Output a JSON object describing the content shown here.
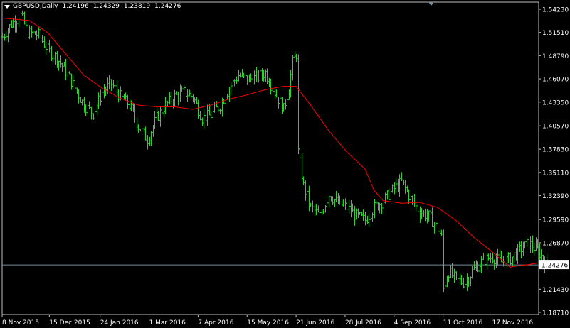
{
  "window": {
    "symbol": "GBPUSD",
    "timeframe": "Daily",
    "ohlc": [
      "1.24196",
      "1.24329",
      "1.23819",
      "1.24276"
    ]
  },
  "colors": {
    "background": "#000000",
    "bar": "#32cd32",
    "moving_average": "#ff0000",
    "axis": "#c0c0c0",
    "current_price_line": "#778899",
    "current_price_label_bg": "#ffffff",
    "current_price_label_fg": "#000000"
  },
  "chart_data": {
    "type": "ohlc-bar",
    "y_ticks": [
      "1.54230",
      "1.51510",
      "1.48790",
      "1.46070",
      "1.43350",
      "1.40570",
      "1.37830",
      "1.35110",
      "1.32390",
      "1.29590",
      "1.26870",
      "1.24276",
      "1.21430",
      "1.18710"
    ],
    "y_tick_values": [
      1.5423,
      1.5151,
      1.4879,
      1.4607,
      1.4335,
      1.4057,
      1.3783,
      1.3511,
      1.3239,
      1.2959,
      1.2687,
      1.24276,
      1.2143,
      1.1871
    ],
    "ylim": [
      1.1871,
      1.5423
    ],
    "current_price": "1.24276",
    "x_ticks": [
      "8 Nov 2015",
      "15 Dec 2015",
      "24 Jan 2016",
      "1 Mar 2016",
      "7 Apr 2016",
      "15 May 2016",
      "21 Jun 2016",
      "28 Jul 2016",
      "4 Sep 2016",
      "11 Oct 2016",
      "17 Nov 2016"
    ],
    "x_tick_bar_index": [
      0,
      26,
      54,
      81,
      108,
      135,
      162,
      189,
      216,
      243,
      270
    ],
    "price_path": [
      [
        0,
        1.51
      ],
      [
        5,
        1.525
      ],
      [
        10,
        1.535
      ],
      [
        14,
        1.515
      ],
      [
        20,
        1.512
      ],
      [
        25,
        1.495
      ],
      [
        30,
        1.485
      ],
      [
        35,
        1.47
      ],
      [
        40,
        1.45
      ],
      [
        45,
        1.43
      ],
      [
        50,
        1.42
      ],
      [
        55,
        1.445
      ],
      [
        60,
        1.455
      ],
      [
        65,
        1.44
      ],
      [
        70,
        1.43
      ],
      [
        75,
        1.405
      ],
      [
        80,
        1.39
      ],
      [
        85,
        1.415
      ],
      [
        90,
        1.43
      ],
      [
        95,
        1.44
      ],
      [
        100,
        1.445
      ],
      [
        105,
        1.44
      ],
      [
        110,
        1.415
      ],
      [
        115,
        1.418
      ],
      [
        120,
        1.43
      ],
      [
        125,
        1.45
      ],
      [
        130,
        1.465
      ],
      [
        135,
        1.46
      ],
      [
        140,
        1.462
      ],
      [
        145,
        1.468
      ],
      [
        150,
        1.445
      ],
      [
        155,
        1.425
      ],
      [
        158,
        1.45
      ],
      [
        160,
        1.48
      ],
      [
        162,
        1.49
      ],
      [
        163,
        1.375
      ],
      [
        166,
        1.335
      ],
      [
        170,
        1.31
      ],
      [
        175,
        1.3
      ],
      [
        180,
        1.325
      ],
      [
        185,
        1.315
      ],
      [
        190,
        1.31
      ],
      [
        195,
        1.3
      ],
      [
        200,
        1.295
      ],
      [
        205,
        1.31
      ],
      [
        210,
        1.318
      ],
      [
        215,
        1.33
      ],
      [
        220,
        1.34
      ],
      [
        225,
        1.32
      ],
      [
        230,
        1.305
      ],
      [
        235,
        1.3
      ],
      [
        240,
        1.285
      ],
      [
        242,
        1.275
      ],
      [
        243,
        1.215
      ],
      [
        246,
        1.235
      ],
      [
        250,
        1.225
      ],
      [
        255,
        1.222
      ],
      [
        260,
        1.238
      ],
      [
        265,
        1.248
      ],
      [
        270,
        1.252
      ],
      [
        275,
        1.246
      ],
      [
        280,
        1.25
      ],
      [
        285,
        1.26
      ],
      [
        290,
        1.268
      ],
      [
        295,
        1.26
      ],
      [
        300,
        1.243
      ]
    ],
    "ma_path": [
      [
        0,
        1.532
      ],
      [
        15,
        1.529
      ],
      [
        25,
        1.515
      ],
      [
        35,
        1.49
      ],
      [
        45,
        1.465
      ],
      [
        55,
        1.45
      ],
      [
        65,
        1.438
      ],
      [
        75,
        1.43
      ],
      [
        85,
        1.428
      ],
      [
        95,
        1.428
      ],
      [
        105,
        1.425
      ],
      [
        115,
        1.43
      ],
      [
        125,
        1.437
      ],
      [
        135,
        1.442
      ],
      [
        145,
        1.448
      ],
      [
        155,
        1.452
      ],
      [
        162,
        1.452
      ],
      [
        170,
        1.43
      ],
      [
        180,
        1.4
      ],
      [
        190,
        1.375
      ],
      [
        200,
        1.355
      ],
      [
        205,
        1.33
      ],
      [
        210,
        1.318
      ],
      [
        220,
        1.315
      ],
      [
        230,
        1.316
      ],
      [
        240,
        1.31
      ],
      [
        250,
        1.295
      ],
      [
        260,
        1.275
      ],
      [
        270,
        1.258
      ],
      [
        280,
        1.24
      ],
      [
        285,
        1.242
      ],
      [
        290,
        1.243
      ],
      [
        295,
        1.245
      ],
      [
        300,
        1.244
      ]
    ]
  }
}
